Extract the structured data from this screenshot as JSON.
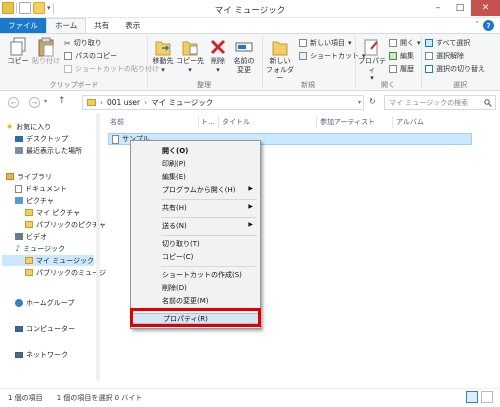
{
  "window": {
    "title": "マイ ミュージック",
    "minimize": "–",
    "maximize": "□",
    "close": "✕"
  },
  "tabs": [
    {
      "label": "ファイル"
    },
    {
      "label": "ホーム"
    },
    {
      "label": "共有"
    },
    {
      "label": "表示"
    }
  ],
  "help_label": "?",
  "ribbon": {
    "clipboard": {
      "group_label": "クリップボード",
      "copy": "コピー",
      "paste": "貼り付け",
      "cut": "切り取り",
      "copy_path": "パスのコピー",
      "paste_shortcut": "ショートカットの貼り付け"
    },
    "organize": {
      "group_label": "整理",
      "move_to_1": "移動先",
      "copy_to_1": "コピー先",
      "delete": "削除",
      "rename_1": "名前の",
      "rename_2": "変更"
    },
    "new": {
      "group_label": "新規",
      "new_folder_1": "新しい",
      "new_folder_2": "フォルダー",
      "new_item": "新しい項目",
      "shortcut": "ショートカット"
    },
    "open": {
      "group_label": "開く",
      "properties": "プロパティ",
      "open": "開く",
      "edit": "編集",
      "history": "履歴"
    },
    "select": {
      "group_label": "選択",
      "select_all": "すべて選択",
      "select_none": "選択解除",
      "invert": "選択の切り替え"
    }
  },
  "address": {
    "segments": [
      "001 user",
      "マイ ミュージック"
    ],
    "sep": "›",
    "search_placeholder": "マイ ミュージックの検索"
  },
  "navpane": {
    "favorites": "お気に入り",
    "desktop": "デスクトップ",
    "recent": "最近表示した場所",
    "libraries": "ライブラリ",
    "documents": "ドキュメント",
    "pictures": "ピクチャ",
    "my_pictures": "マイ ピクチャ",
    "public_pictures": "パブリックのピクチャ",
    "videos": "ビデオ",
    "music": "ミュージック",
    "my_music": "マイ ミュージック",
    "public_music": "パブリックのミュージ",
    "homegroup": "ホームグループ",
    "computer": "コンピューター",
    "network": "ネットワーク"
  },
  "columns": [
    "名前",
    "ト...",
    "タイトル",
    "参加アーティスト",
    "アルバム"
  ],
  "file": {
    "name": "サンプル"
  },
  "context_menu": {
    "open": "開く(O)",
    "print": "印刷(P)",
    "edit": "編集(E)",
    "open_with": "プログラムから開く(H)",
    "share": "共有(H)",
    "send_to": "送る(N)",
    "cut": "切り取り(T)",
    "copy": "コピー(C)",
    "create_shortcut": "ショートカットの作成(S)",
    "delete": "削除(D)",
    "rename": "名前の変更(M)",
    "properties": "プロパティ(R)",
    "arrow": "▶"
  },
  "status": {
    "count": "1 個の項目",
    "selected": "1 個の項目を選択 0 バイト"
  },
  "colors": {
    "accent": "#1979ca",
    "highlight": "#cce8ff",
    "annotation": "#e00000"
  }
}
